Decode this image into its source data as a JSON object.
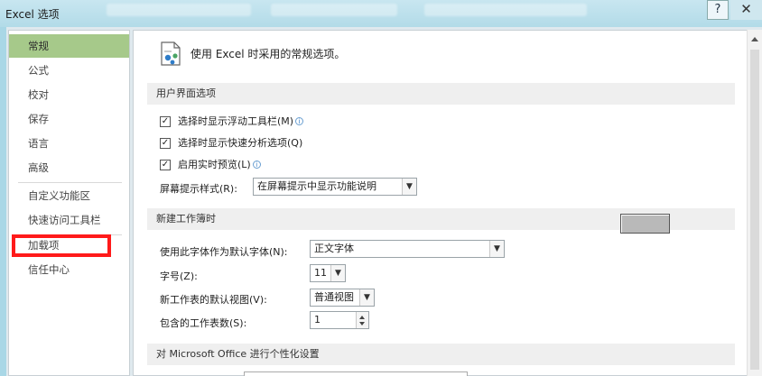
{
  "window": {
    "title": "Excel 选项",
    "help_label": "?",
    "close_label": "✕"
  },
  "nav": {
    "items": [
      {
        "label": "常规",
        "active": true
      },
      {
        "label": "公式"
      },
      {
        "label": "校对"
      },
      {
        "label": "保存"
      },
      {
        "label": "语言"
      },
      {
        "label": "高级"
      },
      {
        "label": "自定义功能区"
      },
      {
        "label": "快速访问工具栏"
      },
      {
        "label": "加载项",
        "highlighted": true
      },
      {
        "label": "信任中心"
      }
    ],
    "highlight_color": "#ff1a1a",
    "active_color": "#a6c98a"
  },
  "main": {
    "header_icon": "general-options-icon",
    "header_text": "使用 Excel 时采用的常规选项。",
    "ui_section": {
      "title": "用户界面选项",
      "checkboxes": [
        {
          "label": "选择时显示浮动工具栏(M)",
          "checked": true,
          "info": true
        },
        {
          "label": "选择时显示快速分析选项(Q)",
          "checked": true,
          "info": false
        },
        {
          "label": "启用实时预览(L)",
          "checked": true,
          "info": true
        }
      ],
      "screentip_label": "屏幕提示样式(R):",
      "screentip_value": "在屏幕提示中显示功能说明"
    },
    "workbook_section": {
      "title": "新建工作簿时",
      "font_label": "使用此字体作为默认字体(N):",
      "font_value": "正文字体",
      "size_label": "字号(Z):",
      "size_value": "11",
      "view_label": "新工作表的默认视图(V):",
      "view_value": "普通视图",
      "sheets_label": "包含的工作表数(S):",
      "sheets_value": "1"
    },
    "personalize_section": {
      "title": "对 Microsoft Office 进行个性化设置"
    }
  },
  "check_mark": "✓",
  "dropdown_arrow": "▼",
  "info_glyph": "i"
}
